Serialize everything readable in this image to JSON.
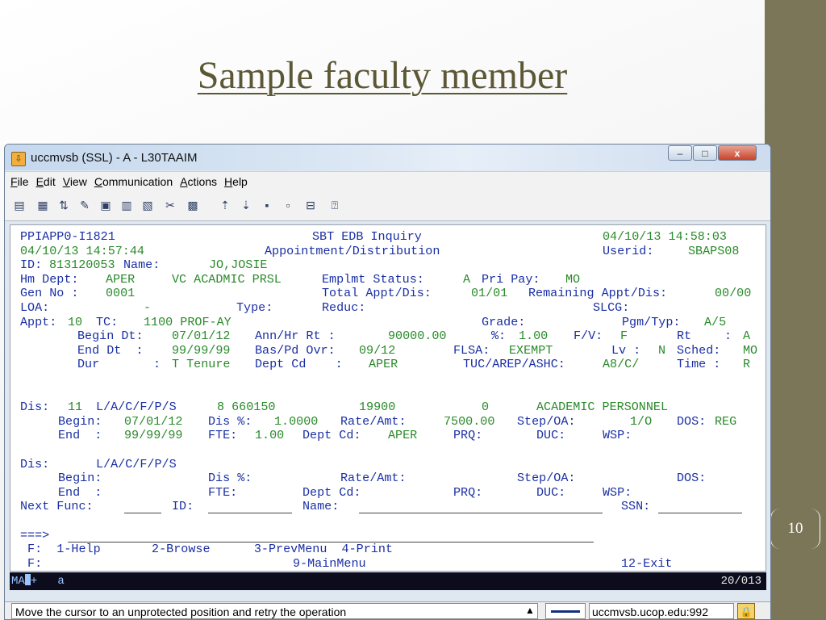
{
  "slide": {
    "title": "Sample faculty member",
    "number": "10"
  },
  "window": {
    "title": "uccmvsb (SSL) - A - L30TAAIM",
    "buttons": {
      "minimize": "–",
      "maximize": "□",
      "close": "x"
    }
  },
  "menu": [
    "File",
    "Edit",
    "View",
    "Communication",
    "Actions",
    "Help"
  ],
  "toolbar_icons": [
    "copy-icon",
    "paste-icon",
    "transfer-icon",
    "macro-icon",
    "print-screen-icon",
    "clipboard-icon",
    "page-setup-icon",
    "customize-icon",
    "keypad-icon",
    "send-file-icon",
    "receive-file-icon",
    "record-icon",
    "stop-icon",
    "disconnect-icon",
    "help-icon"
  ],
  "terminal": {
    "r1a": "PPIAPP0-I1821",
    "r1b": "SBT EDB Inquiry",
    "r1c": "04/10/13 14:58:03",
    "r2a": "04/10/13 14:57:44",
    "r2b": "Appointment/Distribution",
    "r2c": "Userid:",
    "r2d": "SBAPS08",
    "r3a": "ID:",
    "r3b": "813120053",
    "r3c": "Name:",
    "r3d": "JO,JOSIE",
    "r4a": "Hm Dept:",
    "r4b": "APER",
    "r4c": "VC ACADMIC PRSL",
    "r4d": "Emplmt Status:",
    "r4e": "A",
    "r4f": "Pri Pay:",
    "r4g": "MO",
    "r5a": "Gen No :",
    "r5b": "0001",
    "r5c": "Total Appt/Dis:",
    "r5d": "01/01",
    "r5e": "Remaining Appt/Dis:",
    "r5f": "00/00",
    "r6a": "LOA:",
    "r6b": "-",
    "r6c": "Type:",
    "r6d": "Reduc:",
    "r6e": "SLCG:",
    "r7a": "Appt:",
    "r7b": "10",
    "r7c": "TC:",
    "r7d": "1100 PROF-AY",
    "r7e": "Grade:",
    "r7f": "Pgm/Typ:",
    "r7g": "A/5",
    "r8a": "Begin Dt:",
    "r8b": "07/01/12",
    "r8c": "Ann/Hr Rt :",
    "r8d": "90000.00",
    "r8e": "%:",
    "r8f": "1.00",
    "r8g": "F/V:",
    "r8h": "F",
    "r8i": "Rt",
    "r8j": ":",
    "r8k": "A",
    "r9a": "End Dt  :",
    "r9b": "99/99/99",
    "r9c": "Bas/Pd Ovr:",
    "r9d": "09/12",
    "r9e": "FLSA:",
    "r9f": "EXEMPT",
    "r9g": "Lv :",
    "r9h": "N",
    "r9i": "Sched:",
    "r9j": "MO",
    "r10a": "Dur",
    "r10b": ":",
    "r10c": "T Tenure",
    "r10d": "Dept Cd    :",
    "r10e": "APER",
    "r10f": "TUC/AREP/ASHC:",
    "r10g": "A8/C/",
    "r10h": "Time :",
    "r10i": "R",
    "d1a": "Dis:",
    "d1b": "11",
    "d1c": "L/A/C/F/P/S",
    "d1d": "8 660150",
    "d1e": "19900",
    "d1f": "0",
    "d1g": "ACADEMIC PERSONNEL",
    "d2a": "Begin:",
    "d2b": "07/01/12",
    "d2c": "Dis %:",
    "d2d": "1.0000",
    "d2e": "Rate/Amt:",
    "d2f": "7500.00",
    "d2g": "Step/OA:",
    "d2h": "1/O",
    "d2i": "DOS:",
    "d2j": "REG",
    "d3a": "End  :",
    "d3b": "99/99/99",
    "d3c": "FTE:",
    "d3d": "1.00",
    "d3e": "Dept Cd:",
    "d3f": "APER",
    "d3g": "PRQ:",
    "d3h": "DUC:",
    "d3i": "WSP:",
    "e1a": "Dis:",
    "e1b": "L/A/C/F/P/S",
    "e2a": "Begin:",
    "e2b": "Dis %:",
    "e2c": "Rate/Amt:",
    "e2d": "Step/OA:",
    "e2e": "DOS:",
    "e3a": "End  :",
    "e3b": "FTE:",
    "e3c": "Dept Cd:",
    "e3d": "PRQ:",
    "e3e": "DUC:",
    "e3f": "WSP:",
    "nf_label": "Next Func:",
    "id_label": "ID:",
    "name_label": "Name:",
    "ssn_label": "SSN:",
    "cmd_prompt": "===>",
    "f1": " F:  1-Help       2-Browse      3-PrevMenu  4-Print",
    "f2a": " F:",
    "f2b": "9-MainMenu",
    "f2c": "12-Exit"
  },
  "oia": {
    "left_a": "MA",
    "left_b": "+   a",
    "right": "20/013"
  },
  "status": {
    "message": "Move the cursor to an unprotected position and retry the operation",
    "host": "uccmvsb.ucop.edu:992"
  }
}
